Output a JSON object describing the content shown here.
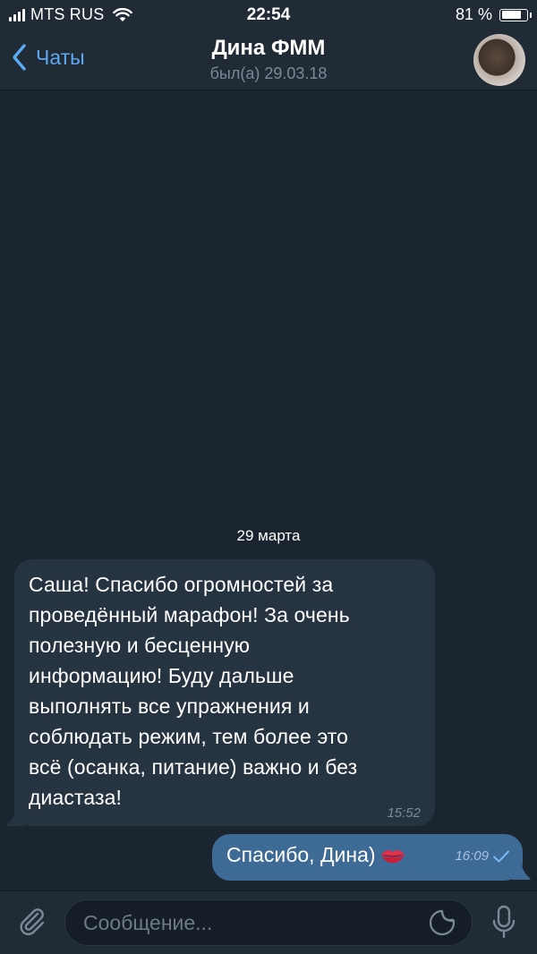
{
  "status_bar": {
    "carrier": "MTS RUS",
    "time": "22:54",
    "battery_percent": "81 %",
    "battery_level": 0.81,
    "signal_icon": "cellular-signal-icon",
    "wifi_icon": "wifi-icon"
  },
  "header": {
    "back_label": "Чаты",
    "title": "Дина ФММ",
    "subtitle": "был(а) 29.03.18",
    "avatar_icon": "contact-avatar"
  },
  "chat": {
    "date_separator": "29 марта",
    "messages": [
      {
        "direction": "incoming",
        "lines": [
          "Саша! Спасибо огромностей за",
          "проведённый марафон! За очень",
          "полезную и бесценную",
          "информацию! Буду дальше",
          "выполнять все упражнения и",
          "соблюдать режим, тем более это",
          "всё (осанка, питание) важно и без",
          "диастаза!"
        ],
        "time": "15:52"
      },
      {
        "direction": "outgoing",
        "text": "Спасибо, Дина)",
        "emoji_icon": "kiss-mark-icon",
        "time": "16:09",
        "status_icon": "single-check-icon"
      }
    ]
  },
  "input_bar": {
    "placeholder": "Сообщение...",
    "value": "",
    "attach_icon": "paperclip-icon",
    "sticker_icon": "sticker-icon",
    "mic_icon": "microphone-icon"
  },
  "colors": {
    "accent": "#5ea9f4",
    "header_bg": "#202b36",
    "chat_bg": "#1b2530",
    "incoming_bubble": "#263442",
    "outgoing_bubble": "#3e6a96"
  }
}
